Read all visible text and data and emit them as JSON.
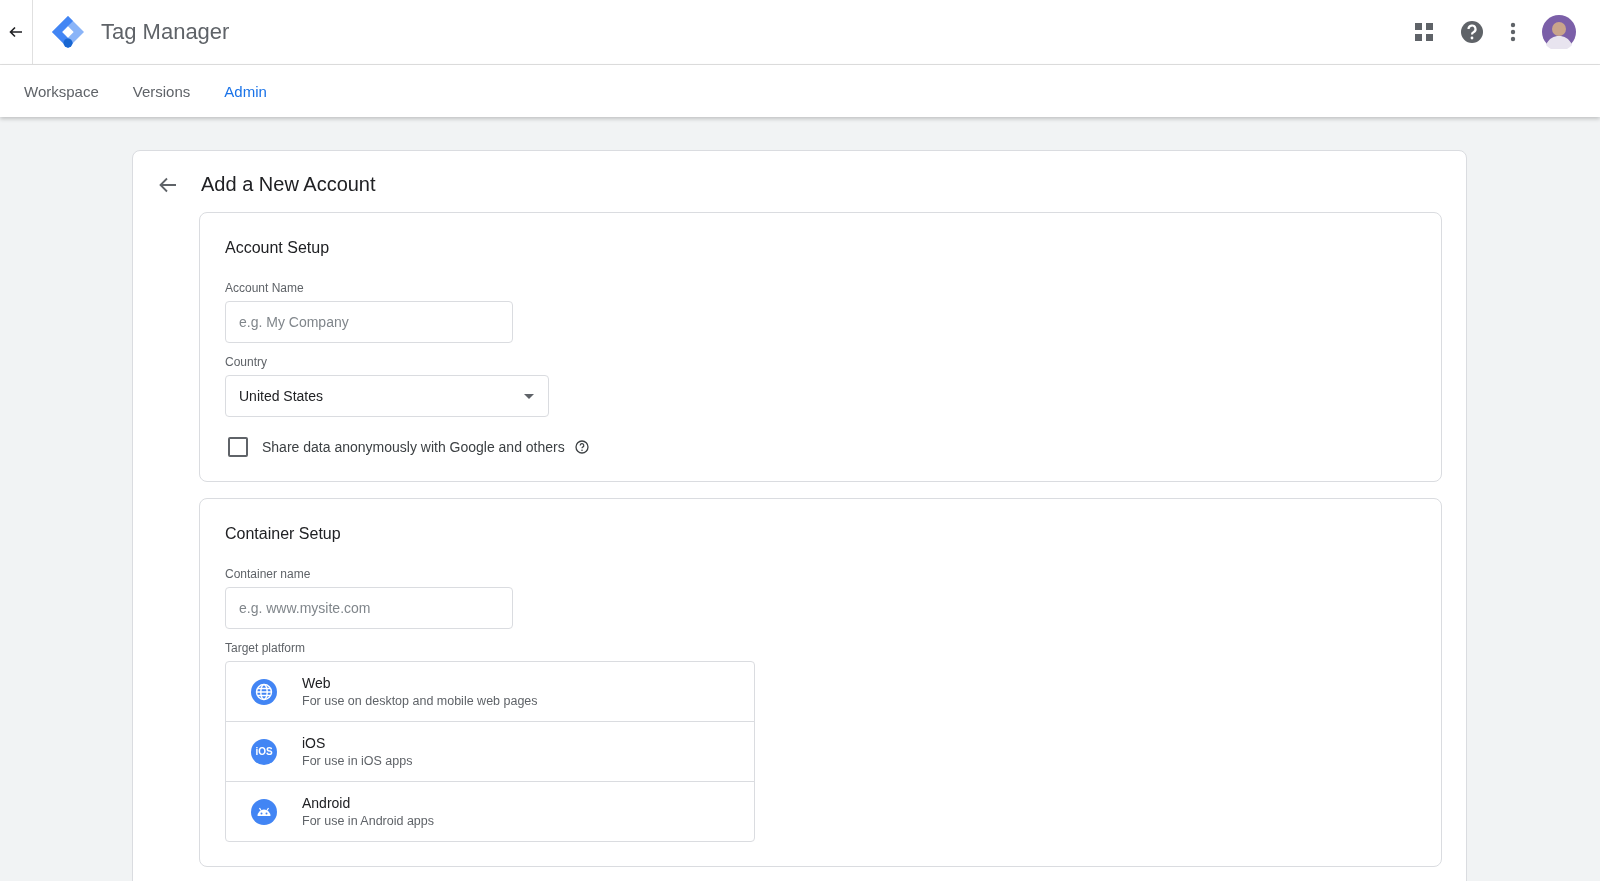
{
  "app": {
    "title": "Tag Manager"
  },
  "tabs": [
    {
      "label": "Workspace",
      "selected": false
    },
    {
      "label": "Versions",
      "selected": false
    },
    {
      "label": "Admin",
      "selected": true
    }
  ],
  "page": {
    "title": "Add a New Account"
  },
  "account_setup": {
    "heading": "Account Setup",
    "account_name": {
      "label": "Account Name",
      "placeholder": "e.g. My Company"
    },
    "country": {
      "label": "Country",
      "value": "United States"
    },
    "share_data": {
      "label": "Share data anonymously with Google and others",
      "checked": false
    }
  },
  "container_setup": {
    "heading": "Container Setup",
    "container_name": {
      "label": "Container name",
      "placeholder": "e.g. www.mysite.com"
    },
    "target_platform": {
      "label": "Target platform",
      "options": [
        {
          "kind": "web",
          "name": "Web",
          "description": "For use on desktop and mobile web pages"
        },
        {
          "kind": "ios",
          "name": "iOS",
          "description": "For use in iOS apps",
          "badge": "iOS"
        },
        {
          "kind": "android",
          "name": "Android",
          "description": "For use in Android apps"
        }
      ]
    }
  }
}
